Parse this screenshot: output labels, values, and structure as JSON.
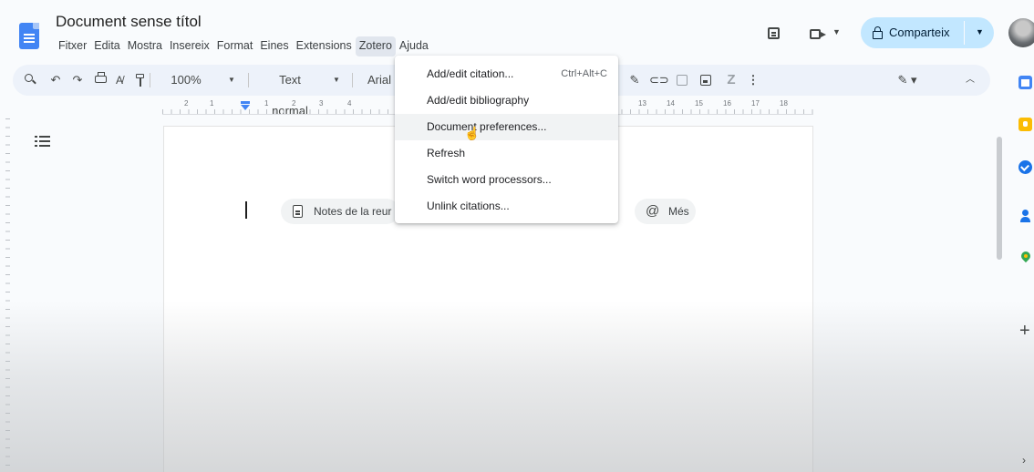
{
  "window": {
    "doc_title": "Document sense títol"
  },
  "menu": {
    "items": [
      "Fitxer",
      "Edita",
      "Mostra",
      "Insereix",
      "Format",
      "Eines",
      "Extensions",
      "Zotero",
      "Ajuda"
    ],
    "open_item": "Zotero"
  },
  "header_actions": {
    "share_label": "Comparteix",
    "share_color": "#c2e7ff"
  },
  "toolbar": {
    "zoom": "100%",
    "paragraph_style": "Text normal",
    "font": "Arial",
    "edit_mode_icon": "pencil-icon"
  },
  "ruler": {
    "numbers": [
      "2",
      "1",
      "1",
      "2",
      "3",
      "4",
      "13",
      "14",
      "15",
      "16",
      "17",
      "18"
    ]
  },
  "document": {
    "chips": {
      "notes_label": "Notes de la reur",
      "more_label": "Més"
    }
  },
  "zotero_menu": {
    "items": [
      {
        "label": "Add/edit citation...",
        "shortcut": "Ctrl+Alt+C"
      },
      {
        "label": "Add/edit bibliography",
        "shortcut": ""
      },
      {
        "label": "Document preferences...",
        "shortcut": "",
        "hovered": true
      },
      {
        "label": "Refresh",
        "shortcut": ""
      },
      {
        "label": "Switch word processors...",
        "shortcut": ""
      },
      {
        "label": "Unlink citations...",
        "shortcut": ""
      }
    ]
  },
  "side_panel": {
    "icons": [
      "calendar-icon",
      "keep-icon",
      "tasks-icon",
      "contacts-icon",
      "maps-icon",
      "add-icon"
    ]
  },
  "colors": {
    "accent": "#4285f4",
    "page_bg": "#f9fbfd",
    "toolbar_bg": "#edf2fa"
  }
}
